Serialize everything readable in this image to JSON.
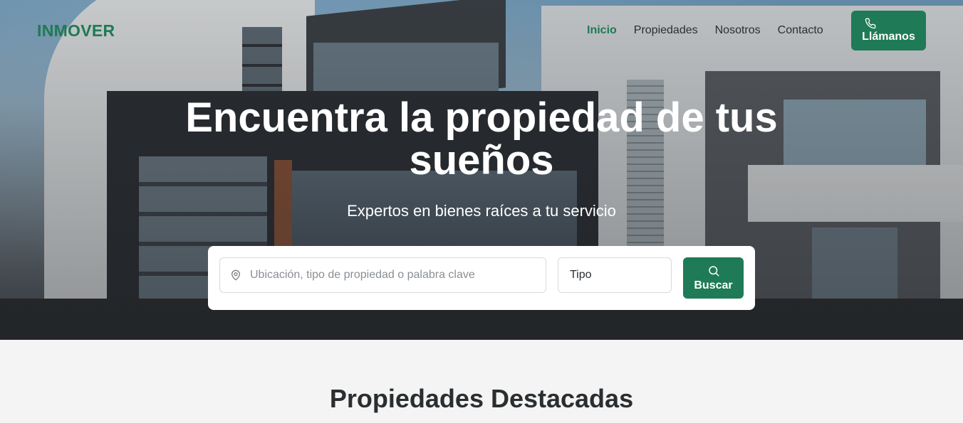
{
  "brand": {
    "logo": "INMOVER",
    "accent": "#1f7a57"
  },
  "nav": {
    "items": [
      {
        "label": "Inicio",
        "active": true
      },
      {
        "label": "Propiedades",
        "active": false
      },
      {
        "label": "Nosotros",
        "active": false
      },
      {
        "label": "Contacto",
        "active": false
      }
    ],
    "call_button": {
      "label": "Llámanos",
      "icon": "phone-icon"
    }
  },
  "hero": {
    "title": "Encuentra la propiedad de tus sueños",
    "subtitle": "Expertos en bienes raíces a tu servicio"
  },
  "search": {
    "location_placeholder": "Ubicación, tipo de propiedad o palabra clave",
    "location_icon": "map-pin-icon",
    "type_value": "Tipo",
    "button_label": "Buscar",
    "button_icon": "search-icon"
  },
  "featured": {
    "title": "Propiedades Destacadas"
  }
}
